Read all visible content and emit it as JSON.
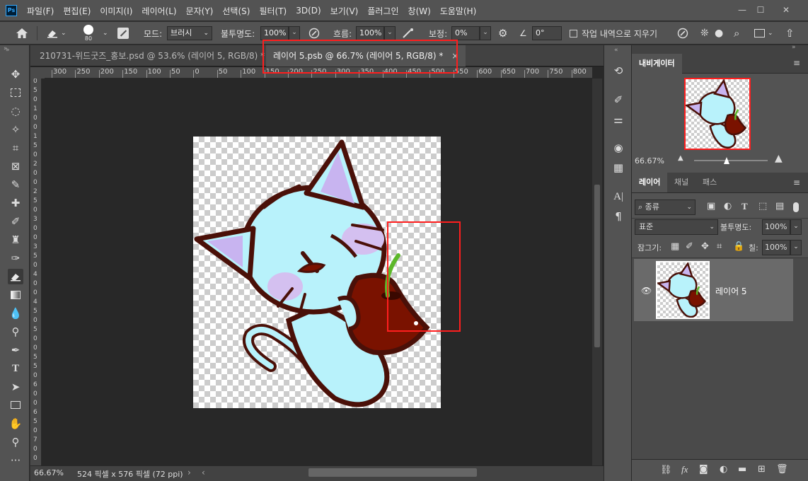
{
  "app": {
    "logo": "Ps"
  },
  "menu": [
    "파일(F)",
    "편집(E)",
    "이미지(I)",
    "레이어(L)",
    "문자(Y)",
    "선택(S)",
    "필터(T)",
    "3D(D)",
    "보기(V)",
    "플러그인",
    "창(W)",
    "도움말(H)"
  ],
  "window_controls": {
    "minimize": "—",
    "maximize": "☐",
    "close": "✕"
  },
  "options": {
    "brush_size": "80",
    "mode_label": "모드:",
    "mode_value": "브러시",
    "opacity_label": "불투명도:",
    "opacity_value": "100%",
    "flow_label": "흐름:",
    "flow_value": "100%",
    "smoothing_label": "보정:",
    "smoothing_value": "0%",
    "angle_value": "0°",
    "history_label": "작업 내역으로 지우기"
  },
  "tabs": [
    {
      "label": "210731-위드굿즈_홍보.psd @ 53.6% (레이어 5, RGB/8) *"
    },
    {
      "label": "레이어 5.psb @ 66.7% (레이어 5, RGB/8) *",
      "close": "×"
    }
  ],
  "ruler_h": [
    "300",
    "250",
    "200",
    "150",
    "100",
    "50",
    "0",
    "50",
    "100",
    "150",
    "200",
    "250",
    "300",
    "350",
    "400",
    "450",
    "500",
    "550",
    "600",
    "650",
    "700",
    "750",
    "800"
  ],
  "ruler_v": [
    "0",
    "5",
    "0",
    "1",
    "0",
    "0",
    "1",
    "5",
    "0",
    "2",
    "0",
    "0",
    "2",
    "5",
    "0",
    "3",
    "0",
    "0",
    "3",
    "5",
    "0",
    "4",
    "0",
    "0",
    "4",
    "5",
    "0",
    "5",
    "0",
    "0",
    "5",
    "5",
    "0",
    "6",
    "0",
    "0",
    "6",
    "5",
    "0",
    "7",
    "0",
    "0"
  ],
  "status": {
    "zoom": "66.67%",
    "doc_info": "524 픽셀 x 576 픽셀 (72 ppi)"
  },
  "navigator": {
    "title": "내비게이터",
    "zoom": "66.67%"
  },
  "layers_panel": {
    "tabs": [
      "레이어",
      "채널",
      "패스"
    ],
    "filter_kind": "종류",
    "blend_mode": "표준",
    "opacity_label": "불투명도:",
    "opacity_value": "100%",
    "lock_label": "잠그기:",
    "fill_label": "칠:",
    "fill_value": "100%",
    "layer_name": "레이어 5"
  },
  "colors": {
    "accent": "#31a8ff",
    "highlight": "#ff1e1e",
    "cherry": "#7a1200",
    "cat": "#b8f2fb",
    "ear": "#c8b4f0",
    "outline": "#4a1008",
    "leaf": "#5cb82a"
  }
}
